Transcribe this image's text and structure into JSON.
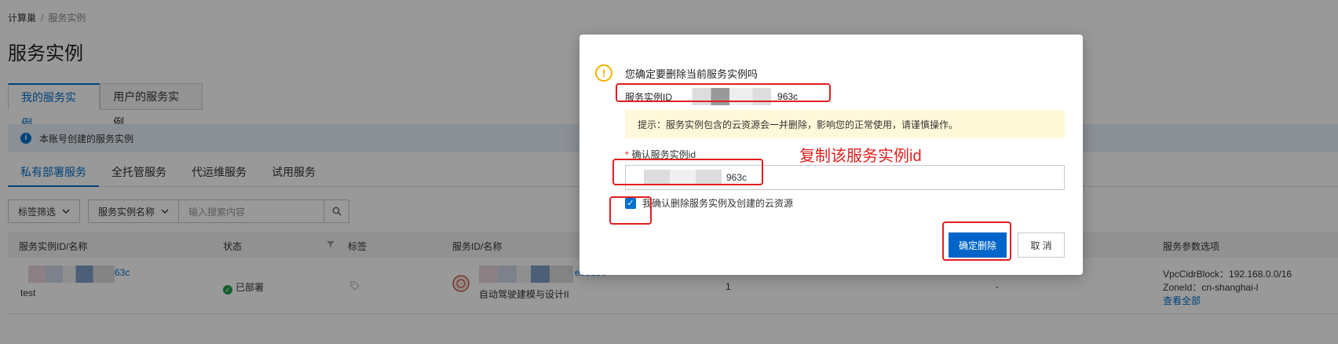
{
  "breadcrumb": {
    "root": "计算巢",
    "sep": "/",
    "current": "服务实例"
  },
  "page_title": "服务实例",
  "main_tabs": [
    {
      "label": "我的服务实例"
    },
    {
      "label": "用户的服务实例"
    }
  ],
  "info_bar": {
    "icon": "i",
    "text": "本账号创建的服务实例"
  },
  "sub_tabs": [
    {
      "label": "私有部署服务"
    },
    {
      "label": "全托管服务"
    },
    {
      "label": "代运维服务"
    },
    {
      "label": "试用服务"
    }
  ],
  "filters": {
    "tag_filter": "标签筛选",
    "name_select": "服务实例名称",
    "search_placeholder": "输入搜索内容"
  },
  "table": {
    "headers": {
      "instance": "服务实例ID/名称",
      "status": "状态",
      "tags": "标签",
      "service": "服务ID/名称",
      "params": "服务参数选项"
    },
    "row": {
      "instance_id_suffix": "63c",
      "instance_name": "test",
      "status_icon": "✓",
      "status": "已部署",
      "service_id_suffix": "e39d90",
      "service_name": "自动驾驶建模与设计II",
      "count": "1",
      "dash": "-",
      "param_cidr": "VpcCidrBlock：192.168.0.0/16",
      "param_zone": "ZoneId：cn-shanghai-l",
      "view_all": "查看全部"
    }
  },
  "dialog": {
    "warn_icon": "!",
    "title": "您确定要删除当前服务实例吗",
    "instance_id_label": "服务实例ID",
    "instance_id_suffix": "963c",
    "tip": "提示：服务实例包含的云资源会一并删除，影响您的正常使用，请谨慎操作。",
    "confirm_required": "*",
    "confirm_label": "确认服务实例id",
    "confirm_value_suffix": "963c",
    "checkbox_mark": "✓",
    "checkbox_label": "我确认删除服务实例及创建的云资源",
    "confirm_button": "确定删除",
    "cancel_button": "取 消"
  },
  "annotation": {
    "text": "复制该服务实例id",
    "color": "#e02020"
  },
  "colors": {
    "primary": "#0064c8",
    "link": "#0070cc",
    "warning": "#f0b400",
    "success": "#1e9e4a"
  }
}
